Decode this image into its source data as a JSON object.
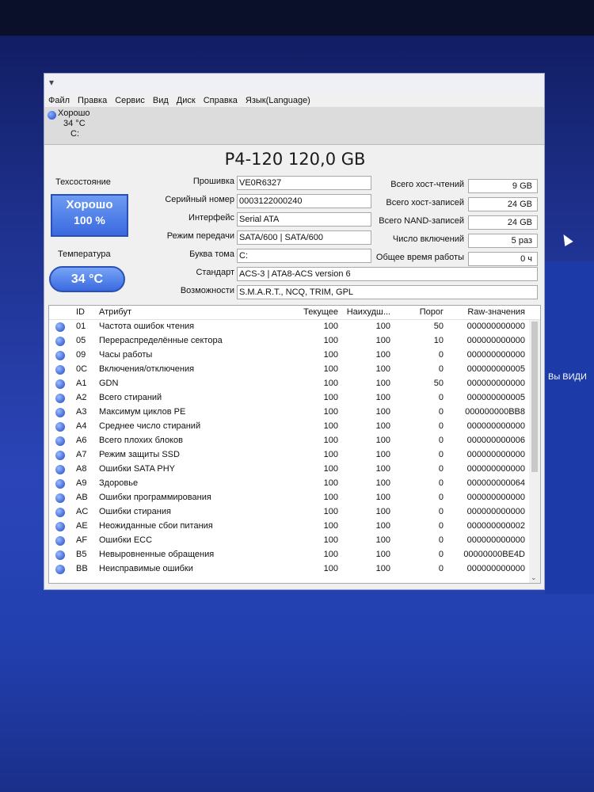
{
  "menu": [
    "Файл",
    "Правка",
    "Сервис",
    "Вид",
    "Диск",
    "Справка",
    "Язык(Language)"
  ],
  "drive_tab": {
    "status": "Хорошо",
    "temperature": "34 °C",
    "letter": "C:"
  },
  "model": "P4-120 120,0 GB",
  "health": {
    "label": "Техсостояние",
    "status": "Хорошо",
    "percent": "100 %"
  },
  "temperature": {
    "label": "Температура",
    "value": "34 °C"
  },
  "info": {
    "firmware_label": "Прошивка",
    "firmware": "VE0R6327",
    "serial_label": "Серийный номер",
    "serial": "0003122000240",
    "interface_label": "Интерфейс",
    "interface": "Serial ATA",
    "transfer_label": "Режим передачи",
    "transfer": "SATA/600 | SATA/600",
    "volume_label": "Буква тома",
    "volume": "C:",
    "standard_label": "Стандарт",
    "standard": "ACS-3 | ATA8-ACS version 6",
    "features_label": "Возможности",
    "features": "S.M.A.R.T., NCQ, TRIM, GPL"
  },
  "stats": {
    "host_reads_label": "Всего хост-чтений",
    "host_reads": "9 GB",
    "host_writes_label": "Всего хост-записей",
    "host_writes": "24 GB",
    "nand_writes_label": "Всего NAND-записей",
    "nand_writes": "24 GB",
    "power_count_label": "Число включений",
    "power_count": "5 раз",
    "power_hours_label": "Общее время работы",
    "power_hours": "0 ч"
  },
  "table": {
    "headers": {
      "id": "ID",
      "attr": "Атрибут",
      "cur": "Текущее",
      "worst": "Наихудш...",
      "thr": "Порог",
      "raw": "Raw-значения"
    },
    "rows": [
      {
        "id": "01",
        "attr": "Частота ошибок чтения",
        "cur": "100",
        "worst": "100",
        "thr": "50",
        "raw": "000000000000"
      },
      {
        "id": "05",
        "attr": "Перераспределённые сектора",
        "cur": "100",
        "worst": "100",
        "thr": "10",
        "raw": "000000000000"
      },
      {
        "id": "09",
        "attr": "Часы работы",
        "cur": "100",
        "worst": "100",
        "thr": "0",
        "raw": "000000000000"
      },
      {
        "id": "0C",
        "attr": "Включения/отключения",
        "cur": "100",
        "worst": "100",
        "thr": "0",
        "raw": "000000000005"
      },
      {
        "id": "A1",
        "attr": "GDN",
        "cur": "100",
        "worst": "100",
        "thr": "50",
        "raw": "000000000000"
      },
      {
        "id": "A2",
        "attr": "Всего стираний",
        "cur": "100",
        "worst": "100",
        "thr": "0",
        "raw": "000000000005"
      },
      {
        "id": "A3",
        "attr": "Максимум циклов PE",
        "cur": "100",
        "worst": "100",
        "thr": "0",
        "raw": "000000000BB8"
      },
      {
        "id": "A4",
        "attr": "Среднее число стираний",
        "cur": "100",
        "worst": "100",
        "thr": "0",
        "raw": "000000000000"
      },
      {
        "id": "A6",
        "attr": "Всего плохих блоков",
        "cur": "100",
        "worst": "100",
        "thr": "0",
        "raw": "000000000006"
      },
      {
        "id": "A7",
        "attr": "Режим защиты SSD",
        "cur": "100",
        "worst": "100",
        "thr": "0",
        "raw": "000000000000"
      },
      {
        "id": "A8",
        "attr": "Ошибки SATA PHY",
        "cur": "100",
        "worst": "100",
        "thr": "0",
        "raw": "000000000000"
      },
      {
        "id": "A9",
        "attr": "Здоровье",
        "cur": "100",
        "worst": "100",
        "thr": "0",
        "raw": "000000000064"
      },
      {
        "id": "AB",
        "attr": "Ошибки программирования",
        "cur": "100",
        "worst": "100",
        "thr": "0",
        "raw": "000000000000"
      },
      {
        "id": "AC",
        "attr": "Ошибки стирания",
        "cur": "100",
        "worst": "100",
        "thr": "0",
        "raw": "000000000000"
      },
      {
        "id": "AE",
        "attr": "Неожиданные сбои питания",
        "cur": "100",
        "worst": "100",
        "thr": "0",
        "raw": "000000000002"
      },
      {
        "id": "AF",
        "attr": "Ошибки ECC",
        "cur": "100",
        "worst": "100",
        "thr": "0",
        "raw": "000000000000"
      },
      {
        "id": "B5",
        "attr": "Невыровненные обращения",
        "cur": "100",
        "worst": "100",
        "thr": "0",
        "raw": "00000000BE4D"
      },
      {
        "id": "BB",
        "attr": "Неисправимые ошибки",
        "cur": "100",
        "worst": "100",
        "thr": "0",
        "raw": "000000000000"
      }
    ]
  },
  "background_text": "Вы ВИДИ"
}
